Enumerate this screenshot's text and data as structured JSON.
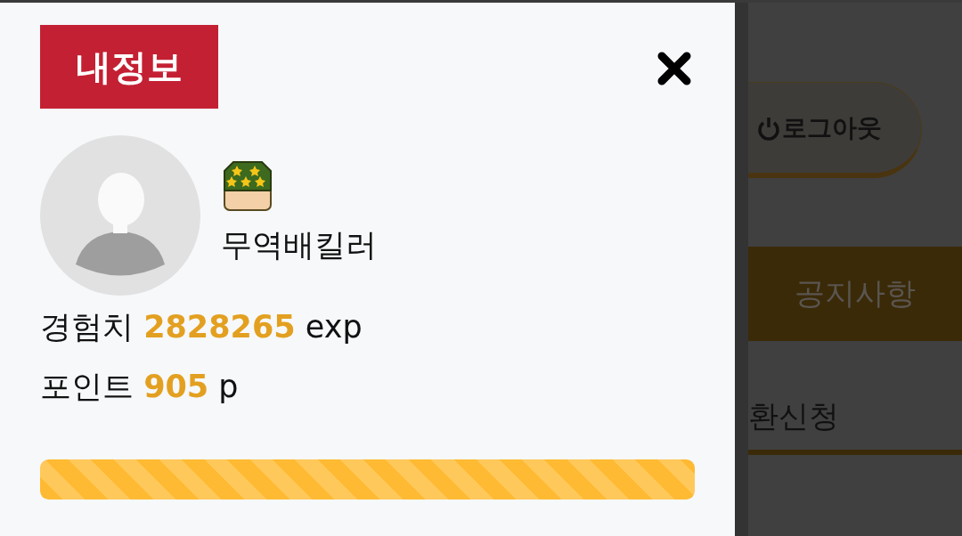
{
  "panel": {
    "title": "내정보",
    "user_name": "무역배킬러",
    "stats": [
      {
        "label": "경험치",
        "value": "2828265",
        "unit": "exp"
      },
      {
        "label": "포인트",
        "value": "905",
        "unit": "p"
      }
    ],
    "progress": {
      "level": 1
    }
  },
  "background": {
    "logout_button": "로그아웃",
    "menu": [
      {
        "kind": "banner",
        "label": "공지사항"
      },
      {
        "kind": "link",
        "label": "환신청"
      }
    ]
  }
}
